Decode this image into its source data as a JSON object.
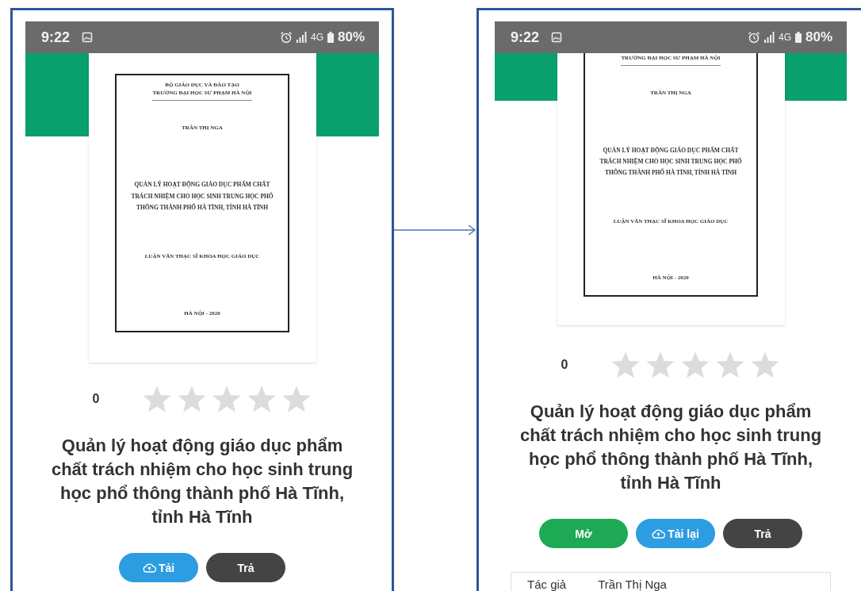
{
  "screens": [
    {
      "scrolled": false,
      "status_bar": {
        "time": "9:22",
        "network": "4G",
        "battery": "80%"
      },
      "cover": {
        "lines": [
          {
            "kind": "small",
            "text": "BỘ GIÁO DỤC VÀ ĐÀO TẠO"
          },
          {
            "kind": "school",
            "text": "TRƯỜNG ĐẠI HỌC SƯ PHẠM HÀ NỘI"
          },
          {
            "kind": "author",
            "text": "TRẦN THỊ NGA"
          },
          {
            "kind": "title",
            "text": "QUẢN LÝ HOẠT ĐỘNG GIÁO DỤC PHẨM CHẤT TRÁCH NHIỆM CHO HỌC SINH TRUNG HỌC PHỔ THÔNG THÀNH PHỐ HÀ TĨNH, TỈNH HÀ TĨNH"
          },
          {
            "kind": "degree",
            "text": "LUẬN VĂN THẠC SĨ KHOA HỌC GIÁO DỤC"
          },
          {
            "kind": "place",
            "text": "HÀ NỘI - 2020"
          }
        ]
      },
      "rating": {
        "count": "0",
        "stars": 0
      },
      "title": "Quản lý hoạt động giáo dục phẩm chất trách nhiệm cho học sinh trung học phổ thông thành phố Hà Tĩnh, tỉnh Hà Tĩnh",
      "buttons": [
        {
          "label": "Tải",
          "kind": "download"
        },
        {
          "label": "Trả",
          "kind": "return"
        }
      ]
    },
    {
      "scrolled": true,
      "status_bar": {
        "time": "9:22",
        "network": "4G",
        "battery": "80%"
      },
      "cover": {
        "lines": [
          {
            "kind": "school",
            "text": "TRƯỜNG ĐẠI HỌC SƯ PHẠM HÀ NỘI"
          },
          {
            "kind": "author",
            "text": "TRẦN THỊ NGA"
          },
          {
            "kind": "title",
            "text": "QUẢN LÝ HOẠT ĐỘNG GIÁO DỤC PHẨM CHẤT TRÁCH NHIỆM CHO HỌC SINH TRUNG HỌC PHỔ THÔNG THÀNH PHỐ HÀ TĨNH, TỈNH HÀ TĨNH"
          },
          {
            "kind": "degree",
            "text": "LUẬN VĂN THẠC SĨ KHOA HỌC GIÁO DỤC"
          },
          {
            "kind": "place",
            "text": "HÀ NỘI - 2020"
          }
        ]
      },
      "rating": {
        "count": "0",
        "stars": 0
      },
      "title": "Quản lý hoạt động giáo dục phẩm chất trách nhiệm cho học sinh trung học phổ thông thành phố Hà Tĩnh, tỉnh Hà Tĩnh",
      "buttons": [
        {
          "label": "Mở",
          "kind": "open"
        },
        {
          "label": "Tải lại",
          "kind": "download"
        },
        {
          "label": "Trả",
          "kind": "return"
        }
      ],
      "info": [
        {
          "label": "Tác giả",
          "value": "Trần Thị Nga"
        }
      ]
    }
  ]
}
